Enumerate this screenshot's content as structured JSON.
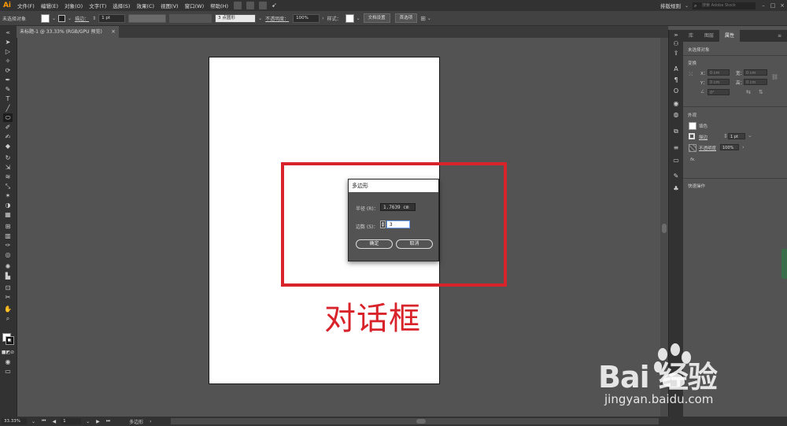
{
  "menubar": {
    "logo": "Ai",
    "items": [
      "文件(F)",
      "编辑(E)",
      "对象(O)",
      "文字(T)",
      "选择(S)",
      "效果(C)",
      "视图(V)",
      "窗口(W)",
      "帮助(H)"
    ],
    "workspace": "排版规则",
    "search_placeholder": "搜索 Adobe Stock"
  },
  "controlbar": {
    "selection": "未选择对象",
    "stroke_label": "描边：",
    "stroke_value": "1 pt",
    "brush_value": "3 点圆形",
    "opacity_label": "不透明度：",
    "opacity_value": "100%",
    "style_label": "样式：",
    "doc_setup": "文档设置",
    "preferences": "首选项"
  },
  "document_tab": {
    "title": "未标题-1 @ 33.33% (RGB/GPU 预览)",
    "close": "×"
  },
  "dialog": {
    "title": "多边形",
    "radius_label": "半径 (R)：",
    "radius_value": "1.7639 cm",
    "sides_label": "边数 (S)：",
    "sides_value": "3",
    "ok": "确定",
    "cancel": "取消"
  },
  "annotation": {
    "label": "对话框",
    "color": "#d9232a"
  },
  "panel": {
    "tabs": [
      "库",
      "图层",
      "属性"
    ],
    "active_tab": "属性",
    "selection": "未选择对象",
    "transform_header": "变换",
    "x_label": "X：",
    "y_label": "Y：",
    "w_label": "宽：",
    "h_label": "高：",
    "x_value": "0 cm",
    "y_value": "0 cm",
    "w_value": "0 cm",
    "h_value": "0 cm",
    "angle_value": "0°",
    "appearance_header": "外观",
    "fill_label": "填色",
    "stroke_label": "描边",
    "stroke_value": "1 pt",
    "opacity_label": "不透明度",
    "opacity_value": "100%",
    "fx": "fx.",
    "quick_actions": "快速操作"
  },
  "statusbar": {
    "zoom": "33.33%",
    "page": "1",
    "tool": "多边形"
  },
  "watermark": {
    "logo": "Bai 经验",
    "url": "jingyan.baidu.com"
  }
}
